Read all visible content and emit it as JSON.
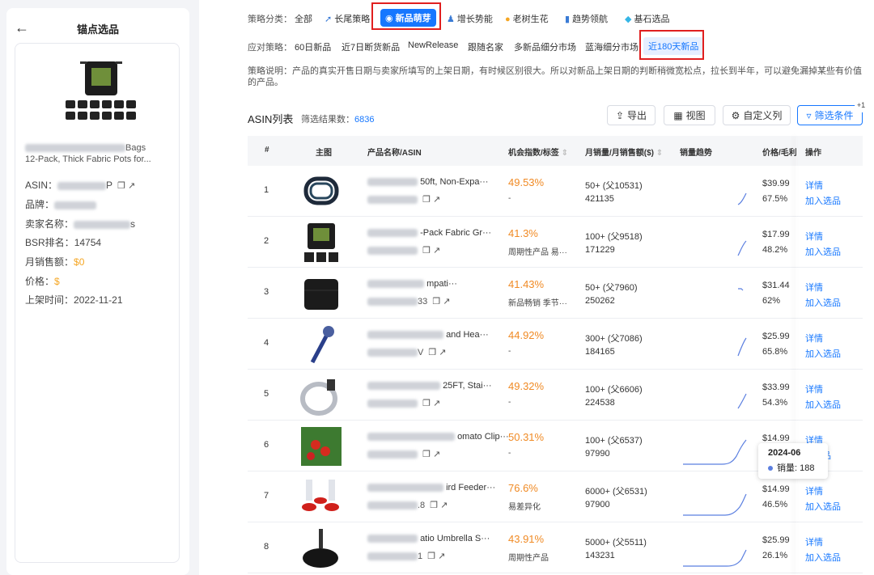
{
  "left": {
    "title": "锚点选品",
    "name_tail": "Bags",
    "name_line2": "12-Pack, Thick Fabric Pots for...",
    "asin_label": "ASIN：",
    "asin_tail": "P",
    "brand_label": "品牌：",
    "seller_label": "卖家名称：",
    "seller_tail": "s",
    "bsr_label": "BSR排名：",
    "bsr_value": "14754",
    "monthly_label": "月销售额：",
    "monthly_value": "$0",
    "price_label": "价格：",
    "price_value": "$",
    "listing_label": "上架时间：",
    "listing_value": "2022-11-21"
  },
  "strategy": {
    "category_label": "策略分类：",
    "categories": [
      {
        "label": "全部",
        "icon": ""
      },
      {
        "label": "长尾策略",
        "icon": "rocket-icon"
      },
      {
        "label": "新品萌芽",
        "icon": "globe-icon"
      },
      {
        "label": "增长势能",
        "icon": "person-icon"
      },
      {
        "label": "老树生花",
        "icon": "bulb-icon"
      },
      {
        "label": "趋势领航",
        "icon": "bar-chart-icon"
      },
      {
        "label": "基石选品",
        "icon": "diamond-icon"
      }
    ],
    "response_label": "应对策略：",
    "responses": [
      "60日新品",
      "近7日断货新品",
      "NewRelease",
      "跟随名家",
      "多新品细分市场",
      "蓝海细分市场",
      "近180天新品"
    ],
    "desc_label": "策略说明：",
    "desc_text": "产品的真实开售日期与卖家所填写的上架日期，有时候区别很大。所以对新品上架日期的判断稍微宽松点，拉长到半年，可以避免漏掉某些有价值的产品。"
  },
  "list": {
    "title": "ASIN列表",
    "result_label": "筛选结果数：",
    "result_count": "6836",
    "btn_export": "导出",
    "btn_view": "视图",
    "btn_custom": "自定义列",
    "btn_filter": "筛选条件",
    "badge": "+1"
  },
  "table": {
    "headers": [
      "#",
      "主图",
      "产品名称/ASIN",
      "机会指数/标签",
      "月销量/月销售额($)",
      "销量趋势",
      "价格/毛利率",
      "操作"
    ],
    "rows": [
      {
        "idx": "1",
        "name": "50ft, Non-Expa···",
        "sub": "",
        "pct": "49.53%",
        "tag": "-",
        "sales": "50+ (父10531)",
        "rev": "421135",
        "price": "$39.99",
        "margin": "67.5%"
      },
      {
        "idx": "2",
        "name": "-Pack Fabric Gr···",
        "sub": "",
        "pct": "41.3%",
        "tag": "周期性产品 易···",
        "sales": "100+ (父9518)",
        "rev": "171229",
        "price": "$17.99",
        "margin": "48.2%"
      },
      {
        "idx": "3",
        "name": "mpati···",
        "sub": "33",
        "pct": "41.43%",
        "tag": "新品畅销 季节···",
        "sales": "50+ (父7960)",
        "rev": "250262",
        "price": "$31.44",
        "margin": "62%"
      },
      {
        "idx": "4",
        "name": "and Hea···",
        "sub": "V",
        "pct": "44.92%",
        "tag": "-",
        "sales": "300+ (父7086)",
        "rev": "184165",
        "price": "$25.99",
        "margin": "65.8%"
      },
      {
        "idx": "5",
        "name": "25FT, Stai···",
        "sub": "",
        "pct": "49.32%",
        "tag": "-",
        "sales": "100+ (父6606)",
        "rev": "224538",
        "price": "$33.99",
        "margin": "54.3%"
      },
      {
        "idx": "6",
        "name": "omato Clip···",
        "sub": "",
        "pct": "50.31%",
        "tag": "-",
        "sales": "100+ (父6537)",
        "rev": "97990",
        "price": "$14.99",
        "margin": ""
      },
      {
        "idx": "7",
        "name": "ird Feeder···",
        "sub": ".8",
        "pct": "76.6%",
        "tag": "易差异化",
        "sales": "6000+ (父6531)",
        "rev": "97900",
        "price": "$14.99",
        "margin": "46.5%"
      },
      {
        "idx": "8",
        "name": "atio Umbrella S···",
        "sub": "1",
        "pct": "43.91%",
        "tag": "周期性产品",
        "sales": "5000+ (父5511)",
        "rev": "143231",
        "price": "$25.99",
        "margin": "26.1%"
      }
    ],
    "detail_label": "详情",
    "add_label": "加入选品",
    "add_partial": "品"
  },
  "tooltip": {
    "date": "2024-06",
    "series": "销量",
    "value": "188"
  },
  "colors": {
    "accent": "#1677ff",
    "orange": "#f08a24",
    "highlight_border": "#e01f1f"
  }
}
